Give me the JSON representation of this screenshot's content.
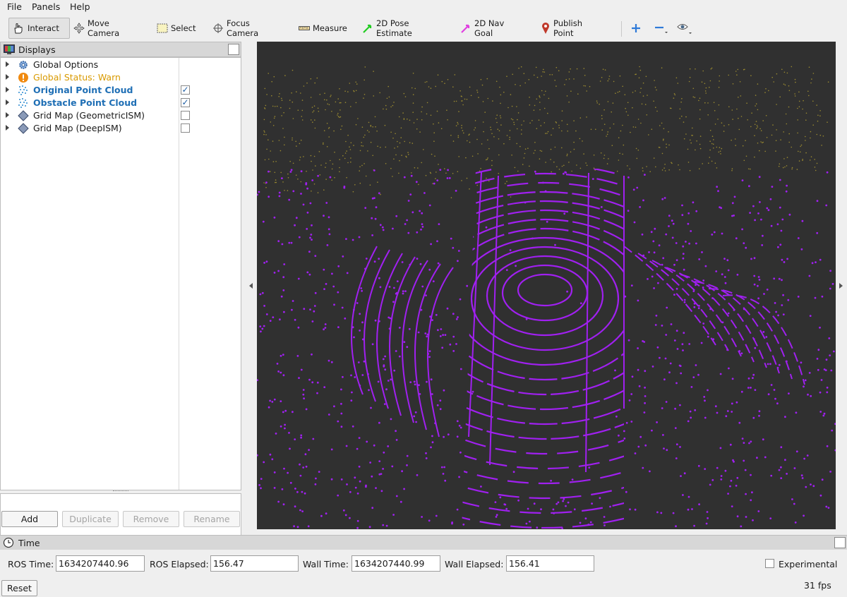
{
  "menu": [
    "File",
    "Panels",
    "Help"
  ],
  "toolbar": {
    "tools": [
      {
        "label": "Interact",
        "icon": "hand-cursor-icon",
        "active": true
      },
      {
        "label": "Move Camera",
        "icon": "move-arrows-icon"
      },
      {
        "label": "Select",
        "icon": "select-box-icon"
      },
      {
        "label": "Focus Camera",
        "icon": "focus-crosshair-icon"
      },
      {
        "label": "Measure",
        "icon": "ruler-icon"
      },
      {
        "label": "2D Pose Estimate",
        "icon": "green-arrow-icon",
        "color": "#22cc22"
      },
      {
        "label": "2D Nav Goal",
        "icon": "magenta-arrow-icon",
        "color": "#e040e0"
      },
      {
        "label": "Publish Point",
        "icon": "map-pin-icon",
        "color": "#c0392b"
      }
    ]
  },
  "displays": {
    "title": "Displays",
    "items": [
      {
        "label": "Global Options",
        "icon": "gear-icon",
        "style": "normal",
        "checkbox": null
      },
      {
        "label": "Global Status: Warn",
        "icon": "warning-icon",
        "style": "warn",
        "checkbox": null
      },
      {
        "label": "Original Point Cloud",
        "icon": "point-cloud-icon",
        "style": "bold",
        "checkbox": true
      },
      {
        "label": "Obstacle Point Cloud",
        "icon": "point-cloud-icon",
        "style": "bold",
        "checkbox": true
      },
      {
        "label": "Grid Map (GeometricISM)",
        "icon": "grid-map-icon",
        "style": "normal",
        "checkbox": false
      },
      {
        "label": "Grid Map (DeepISM)",
        "icon": "grid-map-icon",
        "style": "normal",
        "checkbox": false
      }
    ],
    "buttons": {
      "add": "Add",
      "duplicate": "Duplicate",
      "remove": "Remove",
      "rename": "Rename"
    }
  },
  "viewport": {
    "background": "#303030",
    "cloud_color": "#a020f0",
    "cloud_far_color": "#9a8a30"
  },
  "time": {
    "title": "Time",
    "ros_time_label": "ROS Time:",
    "ros_time": "1634207440.96",
    "ros_elapsed_label": "ROS Elapsed:",
    "ros_elapsed": "156.47",
    "wall_time_label": "Wall Time:",
    "wall_time": "1634207440.99",
    "wall_elapsed_label": "Wall Elapsed:",
    "wall_elapsed": "156.41",
    "experimental_label": "Experimental",
    "reset_label": "Reset",
    "fps": "31 fps"
  }
}
